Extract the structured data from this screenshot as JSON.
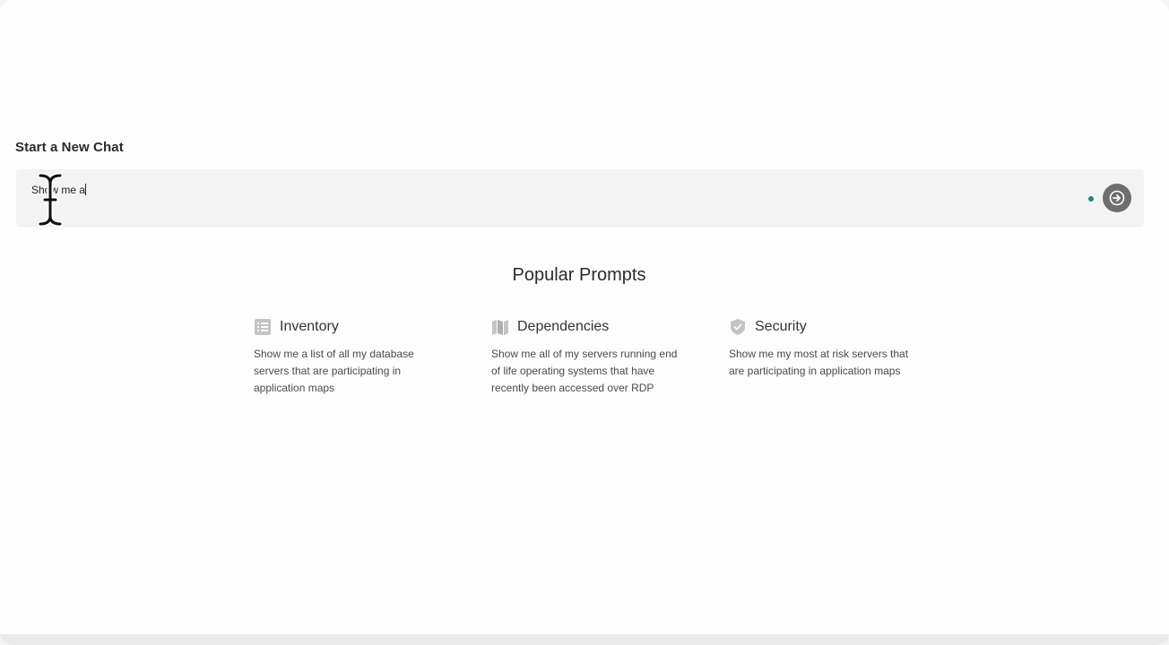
{
  "header": {
    "title": "Start a New Chat"
  },
  "chat": {
    "input_value": "Show me a",
    "status_color": "#1a8b7a",
    "send_icon": "arrow-right-circle-icon"
  },
  "prompts": {
    "title": "Popular Prompts",
    "items": [
      {
        "title": "Inventory",
        "icon": "list-icon",
        "description": "Show me a list of all my database servers that are participating in application maps"
      },
      {
        "title": "Dependencies",
        "icon": "map-icon",
        "description": "Show me all of my servers running end of life operating systems that have recently been accessed over RDP"
      },
      {
        "title": "Security",
        "icon": "shield-icon",
        "description": "Show me my most at risk servers that are participating in application maps"
      }
    ]
  }
}
